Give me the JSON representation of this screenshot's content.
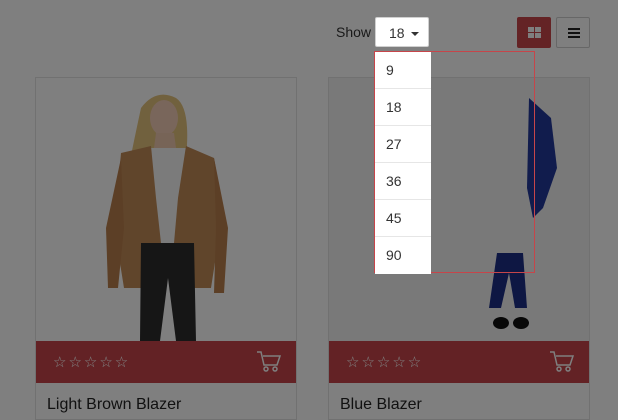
{
  "toolbar": {
    "show_label": "Show",
    "page_size_selected": "18",
    "views": [
      "grid-view",
      "list-view"
    ]
  },
  "page_size_options": [
    "9",
    "18",
    "27",
    "36",
    "45",
    "90"
  ],
  "products": [
    {
      "name": "Light Brown Blazer",
      "rating": 0
    },
    {
      "name": "Blue Blazer",
      "rating": 0
    }
  ],
  "colors": {
    "accent": "#c6454a",
    "overlay": "rgba(0,0,0,0.5)"
  }
}
